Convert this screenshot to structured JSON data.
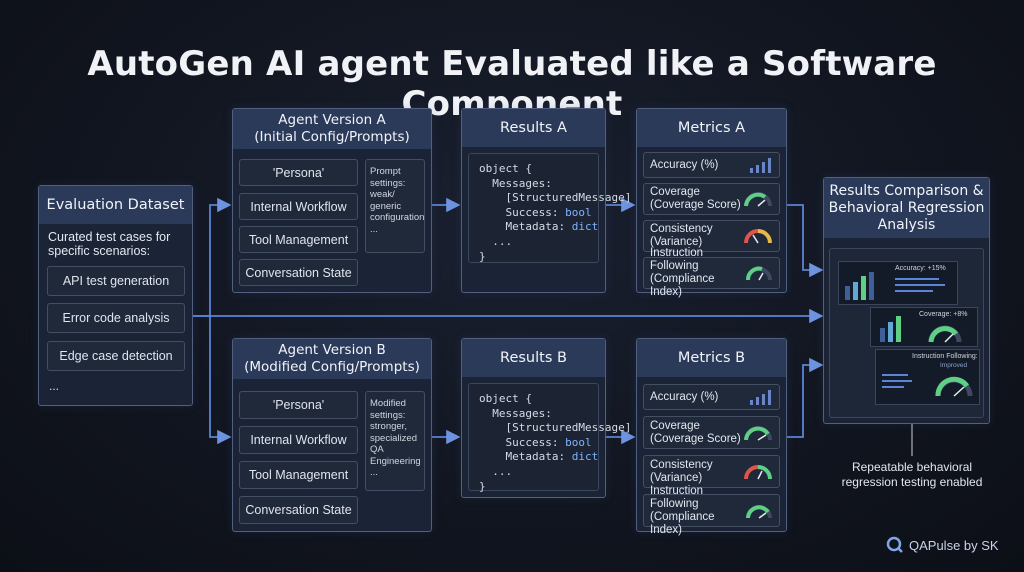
{
  "title": "AutoGen AI agent Evaluated like a Software Component",
  "dataset": {
    "header": "Evaluation Dataset",
    "intro": "Curated test cases for specific scenarios:",
    "items": [
      "API test generation",
      "Error code analysis",
      "Edge case detection"
    ],
    "more": "..."
  },
  "agent_a": {
    "header_line1": "Agent Version A",
    "header_line2": "(Initial Config/Prompts)",
    "items": [
      "'Persona'",
      "Internal Workflow",
      "Tool Management",
      "Conversation State"
    ],
    "note": "Prompt settings: weak/ generic configuration ..."
  },
  "agent_b": {
    "header_line1": "Agent Version B",
    "header_line2": "(Modified Config/Prompts)",
    "items": [
      "'Persona'",
      "Internal Workflow",
      "Tool Management",
      "Conversation State"
    ],
    "note": "Modified settings: stronger, specialized QA Engineering ..."
  },
  "results_a": {
    "header": "Results A",
    "code": [
      "object {",
      "  Messages:",
      "    [StructuredMessage]",
      "    Success: ",
      "    Metadata: ",
      "  ...",
      "}"
    ],
    "types": {
      "success": "bool",
      "metadata": "dict"
    }
  },
  "results_b": {
    "header": "Results B",
    "code": [
      "object {",
      "  Messages:",
      "    [StructuredMessage]",
      "    Success: ",
      "    Metadata: ",
      "  ...",
      "}"
    ],
    "types": {
      "success": "bool",
      "metadata": "dict"
    }
  },
  "metrics_a": {
    "header": "Metrics A",
    "items": [
      {
        "label": "Accuracy (%)",
        "icon": "bar-chart-icon"
      },
      {
        "label": "Coverage (Coverage Score)",
        "icon": "gauge-icon"
      },
      {
        "label": "Consistency (Variance)",
        "icon": "gauge-icon"
      },
      {
        "label": "Instruction Following (Compliance Index)",
        "icon": "gauge-icon"
      }
    ]
  },
  "metrics_b": {
    "header": "Metrics B",
    "items": [
      {
        "label": "Accuracy (%)",
        "icon": "bar-chart-icon"
      },
      {
        "label": "Coverage (Coverage Score)",
        "icon": "gauge-icon"
      },
      {
        "label": "Consistency (Variance)",
        "icon": "gauge-icon"
      },
      {
        "label": "Instruction Following (Compliance Index)",
        "icon": "gauge-icon"
      }
    ]
  },
  "comparison": {
    "header_line1": "Results Comparison &",
    "header_line2": "Behavioral Regression",
    "header_line3": "Analysis",
    "accuracy_label": "Accuracy: +15%",
    "coverage_label": "Coverage: +8%",
    "instruction_label": "Instruction Following:",
    "instruction_sub": "Improved",
    "footnote_line1": "Repeatable behavioral",
    "footnote_line2": "regression testing enabled"
  },
  "brand": "QAPulse by SK",
  "colors": {
    "accent": "#5b84d6",
    "panel": "#1b2436",
    "header": "#2a3a58",
    "type_keyword": "#7fb2ff",
    "gauge_green": "#5fcf86",
    "gauge_red": "#e0554a"
  }
}
